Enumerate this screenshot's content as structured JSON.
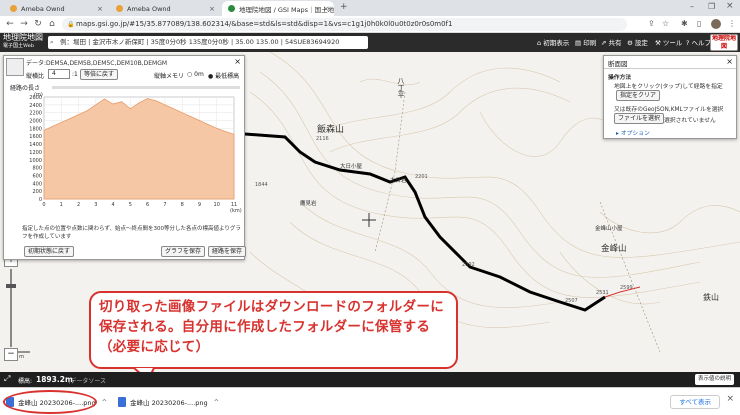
{
  "browser": {
    "tabs": [
      {
        "label": "Ameba Ownd",
        "color": "#e8a13b"
      },
      {
        "label": "Ameba Ownd",
        "color": "#e8a13b"
      },
      {
        "label": "地理院地図 / GSI Maps｜国土地",
        "color": "#2a8c3d"
      }
    ],
    "url": "maps.gsi.go.jp/#15/35.877089/138.602314/&base=std&ls=std&disp=1&vs=c1g1j0h0k0l0u0t0z0r0s0m0f1",
    "icons": [
      "back-icon",
      "forward-icon",
      "reload-icon",
      "home-icon",
      "share-icon",
      "star-icon",
      "extensions-icon",
      "menu-icon"
    ]
  },
  "gsi": {
    "logo_line1": "地理院地図",
    "logo_line2": "電子国土Web",
    "search_text": "例：堀田 | 金沢市木ノ新保町 | 35度0分0秒 135度0分0秒 | 35.00 135.00 | 54SUE83694920",
    "buttons": [
      "初期表示",
      "印刷",
      "共有",
      "設定",
      "ツール",
      "ヘルプ"
    ],
    "vector_label": "地理院地図 Vector"
  },
  "map": {
    "labels": [
      {
        "text": "飯森山",
        "cls": "big"
      },
      {
        "text": "八丁平",
        "cls": "big"
      },
      {
        "text": "大日小屋",
        "cls": "sm"
      },
      {
        "text": "大日岩",
        "cls": "sm"
      },
      {
        "text": "鷹見岩",
        "cls": "sm"
      },
      {
        "text": "金峰山小屋",
        "cls": "sm"
      },
      {
        "text": "金峰山",
        "cls": "big"
      },
      {
        "text": "鉄山",
        "cls": "big"
      },
      {
        "text": "2116",
        "cls": "num"
      },
      {
        "text": "2201",
        "cls": "num"
      },
      {
        "text": "1844",
        "cls": "num"
      },
      {
        "text": "2092",
        "cls": "num"
      },
      {
        "text": "2599",
        "cls": "num"
      },
      {
        "text": "2531",
        "cls": "num"
      },
      {
        "text": "2507",
        "cls": "num"
      }
    ],
    "scale_label": "300 m"
  },
  "profile": {
    "title": "データ:DEM5A,DEM5B,DEM5C,DEM10B,DEMGM",
    "vexag_label": "縦横比",
    "vexag_value": "4",
    "ratio_suffix": ":1",
    "equal_btn": "等倍に戻す",
    "scale_memory_label": "縦軸メモリ",
    "radio_0m": "0m",
    "radio_min": "最低標高",
    "length_label": "経路の長さ",
    "y_unit": "(m)",
    "x_unit": "(km)",
    "note": "指定した点の位置や点数に関わらず、始点～終点間を300等分した各点の標高値よりグラフを作成しています",
    "reset_btn": "初期状態に戻す",
    "save_graph_btn": "グラフを保存",
    "save_route_btn": "経路を保存"
  },
  "chart_data": {
    "type": "area",
    "title": "",
    "xlabel": "(km)",
    "ylabel": "(m)",
    "xlim": [
      0,
      11
    ],
    "ylim": [
      0,
      2600
    ],
    "x_ticks": [
      0,
      1,
      2,
      3,
      4,
      5,
      6,
      7,
      8,
      9,
      10,
      11
    ],
    "y_ticks": [
      0,
      200,
      400,
      600,
      800,
      1000,
      1200,
      1400,
      1600,
      1800,
      2000,
      2200,
      2400,
      2600
    ],
    "x": [
      0,
      0.5,
      1,
      1.5,
      2,
      2.5,
      3,
      3.5,
      4,
      4.5,
      5,
      5.5,
      6,
      6.5,
      7,
      7.5,
      8,
      8.5,
      9,
      9.5,
      10,
      10.5,
      11
    ],
    "values": [
      1750,
      1850,
      1950,
      2050,
      2150,
      2250,
      2400,
      2550,
      2420,
      2480,
      2300,
      2450,
      2560,
      2500,
      2400,
      2300,
      2200,
      2100,
      2000,
      1900,
      1800,
      1720,
      1650
    ]
  },
  "rpanel": {
    "title": "断面図",
    "op_label": "操作方法",
    "line1": "地図上をクリック(タップ)して経路を指定",
    "clear_btn": "指定をクリア",
    "line2": "又は既存のGeoJSON,KMLファイルを選択",
    "file_btn": "ファイルを選択",
    "file_status": "選択されていません",
    "option": "オプション"
  },
  "callout": {
    "text": "切り取った画像ファイルはダウンロードのフォルダーに保存される。自分用に作成したフォルダーに保管する（必要に応じて）"
  },
  "statusbar": {
    "elev_label": "標高:",
    "elev_value": "1893.2m",
    "elev_source": "(データソース",
    "legend_btn": "表示値の説明"
  },
  "downloads": {
    "file1": "金峰山 20230206-....png",
    "file2": "金峰山 20230206-....png",
    "show_all": "すべて表示"
  }
}
